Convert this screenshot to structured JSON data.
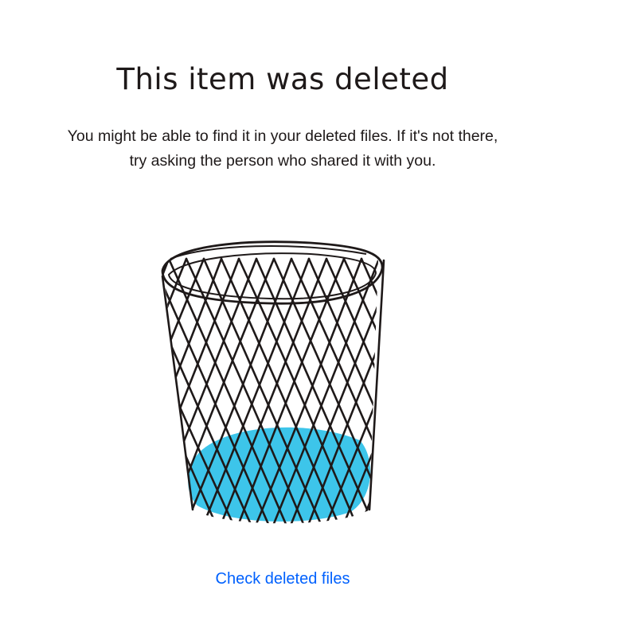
{
  "page": {
    "title": "This item was deleted",
    "description_line1": "You might be able to find it in your deleted files. If it's not there,",
    "description_line2": "try asking the person who shared it with you.",
    "link_label": "Check deleted files"
  },
  "illustration": {
    "icon": "wastebasket-icon",
    "fill_color": "#3dc5ea",
    "stroke_color": "#1e1919"
  },
  "colors": {
    "text": "#1e1919",
    "link": "#0061fe",
    "background": "#ffffff"
  }
}
